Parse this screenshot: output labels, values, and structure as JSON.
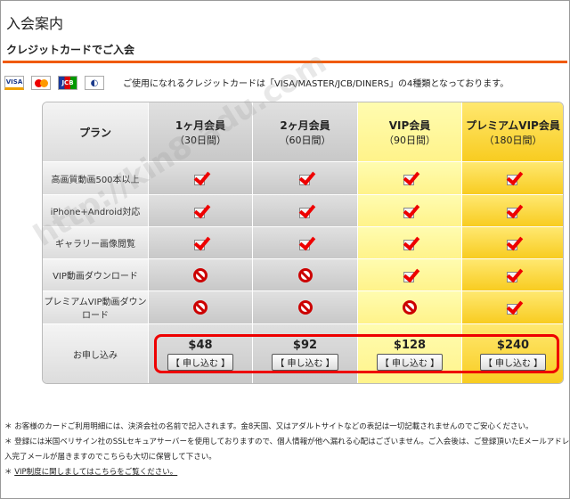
{
  "page": {
    "title": "入会案内",
    "subtitle": "クレジットカードでご入会"
  },
  "cards": {
    "labels": [
      "VISA",
      "MasterCard",
      "JCB",
      "DINERS"
    ],
    "text": "ご使用になれるクレジットカードは「VISA/MASTER/JCB/DINERS」の4種類となっております。"
  },
  "table": {
    "corner": "プラン",
    "plans": [
      {
        "name": "1ヶ月会員",
        "period": "（30日間）",
        "price": "$48"
      },
      {
        "name": "2ヶ月会員",
        "period": "（60日間）",
        "price": "$92"
      },
      {
        "name": "VIP会員",
        "period": "（90日間）",
        "price": "$128"
      },
      {
        "name": "プレミアムVIP会員",
        "period": "（180日間）",
        "price": "$240"
      }
    ],
    "features": [
      {
        "label": "高画質動画500本以上",
        "avail": [
          true,
          true,
          true,
          true
        ]
      },
      {
        "label": "iPhone+Android対応",
        "avail": [
          true,
          true,
          true,
          true
        ]
      },
      {
        "label": "ギャラリー画像閲覧",
        "avail": [
          true,
          true,
          true,
          true
        ]
      },
      {
        "label": "VIP動画ダウンロード",
        "avail": [
          false,
          false,
          true,
          true
        ]
      },
      {
        "label": "プレミアムVIP動画ダウンロード",
        "avail": [
          false,
          false,
          false,
          true
        ]
      }
    ],
    "apply_row_label": "お申し込み",
    "apply_button": "【 申し込む 】"
  },
  "notes": {
    "n1": "＊ お客様のカードご利用明細には、決済会社の名前で記入されます。金8天国、又はアダルトサイトなどの表記は一切記載されませんのでご安心ください。",
    "n2a": "＊ 登録には米国ベリサイン社のSSLセキュアサーバーを使用しておりますので、個人情報が他へ漏れる心配はございません。ご入会後は、ご登録頂いたEメールアドレ",
    "n2b": "入完了メールが届きますのでこちらも大切に保管して下さい。",
    "n3_prefix": "＊ ",
    "n3_link": "VIP制度に関しましてはこちらをご覧ください。"
  },
  "watermark": "http://kin8-adu.com",
  "colors": {
    "accent": "#f05a00",
    "check": "#e00000",
    "vip": "#fff38a",
    "premium": "#f8cc20"
  }
}
